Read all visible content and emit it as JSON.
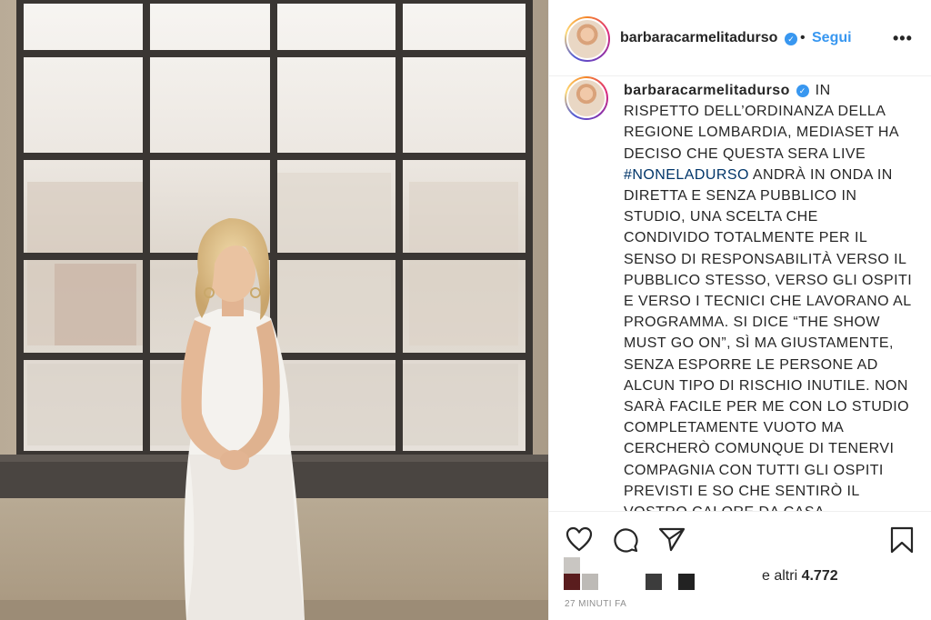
{
  "post": {
    "username": "barbaracarmelitadurso",
    "follow_label": "Segui",
    "separator": "•",
    "more_label": "•••",
    "verified_glyph": "✓",
    "image_alt": "Woman in a white lace dress standing in front of a large industrial window"
  },
  "caption": {
    "username": "barbaracarmelitadurso",
    "lines": [
      "IN",
      "RISPETTO DELL’ORDINANZA DELLA",
      "REGIONE LOMBARDIA, MEDIASET HA",
      "DECISO CHE QUESTA SERA LIVE",
      "ANDRÀ IN ONDA IN",
      "DIRETTA E SENZA PUBBLICO IN",
      "STUDIO, UNA SCELTA CHE",
      "CONDIVIDO TOTALMENTE PER IL",
      "SENSO DI RESPONSABILITÀ VERSO IL",
      "PUBBLICO STESSO, VERSO GLI OSPITI",
      "E VERSO I TECNICI CHE LAVORANO AL",
      "PROGRAMMA. SI DICE “THE SHOW",
      "MUST GO ON”, SÌ MA GIUSTAMENTE,",
      "SENZA ESPORRE LE PERSONE AD",
      "ALCUN TIPO DI RISCHIO INUTILE. NON",
      "SARÀ FACILE PER ME CON LO STUDIO",
      "COMPLETAMENTE VUOTO MA",
      "CERCHERÒ COMUNQUE DI TENERVI",
      "COMPAGNIA CON TUTTI GLI OSPITI",
      "PREVISTI E SO CHE SENTIRÒ IL",
      "VOSTRO CALORE DA CASA"
    ],
    "hashtag": "#NONELADURSO"
  },
  "actions": {
    "like_icon": "heart-icon",
    "comment_icon": "comment-icon",
    "share_icon": "paper-plane-icon",
    "save_icon": "bookmark-icon"
  },
  "likes": {
    "prefix": "e altri ",
    "count": "4.772"
  },
  "timestamp": "27 MINUTI FA",
  "colors": {
    "link": "#3897f0",
    "hashtag": "#003569",
    "text": "#262626",
    "muted": "#8e8e8e",
    "border": "#efefef"
  }
}
